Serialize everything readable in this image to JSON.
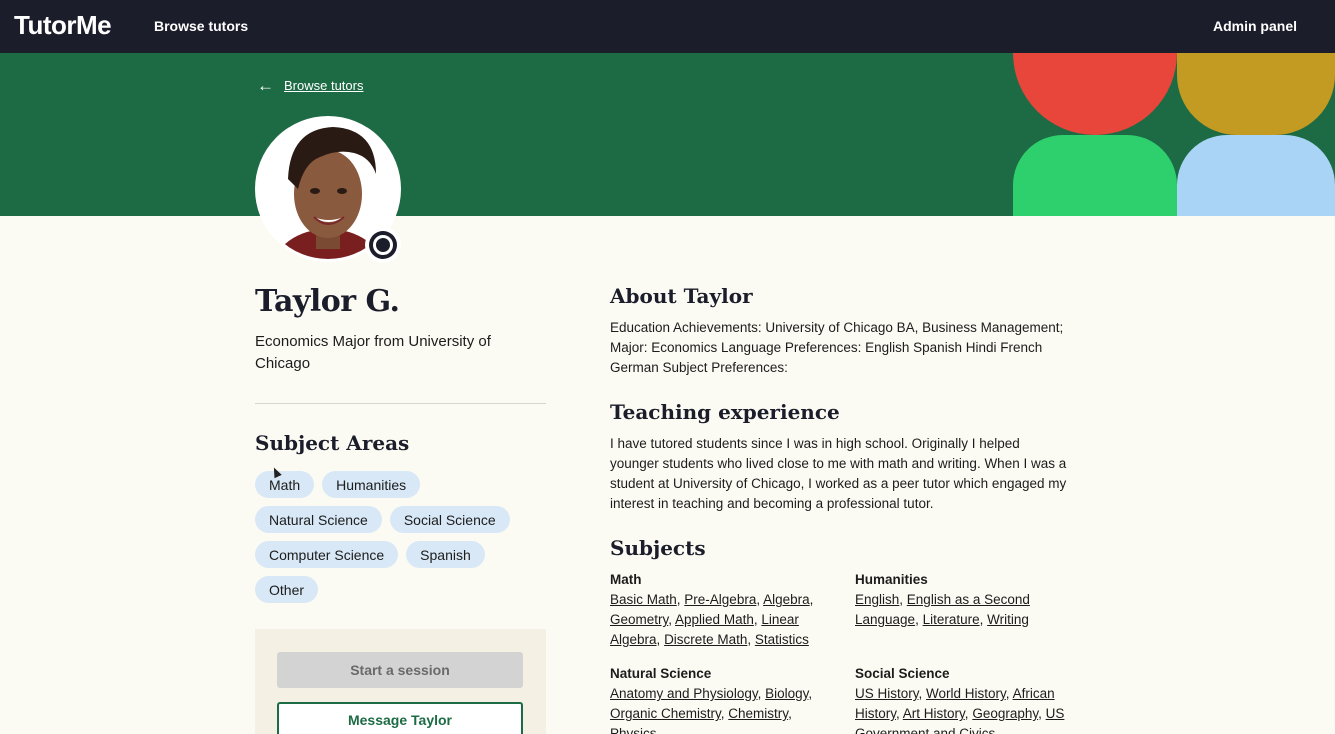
{
  "topnav": {
    "logo": "TutorMe",
    "browse": "Browse tutors",
    "admin": "Admin panel"
  },
  "hero": {
    "back_label": "Browse tutors",
    "shape_colors": {
      "red": "#e8463b",
      "gold": "#c39a22",
      "green": "#2ecf6d",
      "blue": "#a9d4f5"
    }
  },
  "profile": {
    "name": "Taylor G.",
    "headline": "Economics Major from University of Chicago"
  },
  "subject_areas": {
    "title": "Subject Areas",
    "chips": [
      "Math",
      "Humanities",
      "Natural Science",
      "Social Science",
      "Computer Science",
      "Spanish",
      "Other"
    ]
  },
  "actions": {
    "start": "Start a session",
    "message": "Message Taylor"
  },
  "about": {
    "title": "About Taylor",
    "text": "Education Achievements: University of Chicago BA, Business Management; Major: Economics Language Preferences: English Spanish Hindi French German Subject Preferences:"
  },
  "teaching": {
    "title": "Teaching experience",
    "text": "I have tutored students since I was in high school. Originally I helped younger students who lived close to me with math and writing. When I was a student at University of Chicago, I worked as a peer tutor which engaged my interest in teaching and becoming a professional tutor."
  },
  "subjects": {
    "title": "Subjects",
    "groups": [
      {
        "heading": "Math",
        "items": [
          "Basic Math",
          "Pre-Algebra",
          "Algebra",
          "Geometry",
          "Applied Math",
          "Linear Algebra",
          "Discrete Math",
          "Statistics"
        ]
      },
      {
        "heading": "Humanities",
        "items": [
          "English",
          "English as a Second Language",
          "Literature",
          "Writing"
        ]
      },
      {
        "heading": "Natural Science",
        "items": [
          "Anatomy and Physiology",
          "Biology",
          "Organic Chemistry",
          "Chemistry",
          "Physics"
        ]
      },
      {
        "heading": "Social Science",
        "items": [
          "US History",
          "World History",
          "African History",
          "Art History",
          "Geography",
          "US Government and Civics"
        ]
      }
    ]
  }
}
